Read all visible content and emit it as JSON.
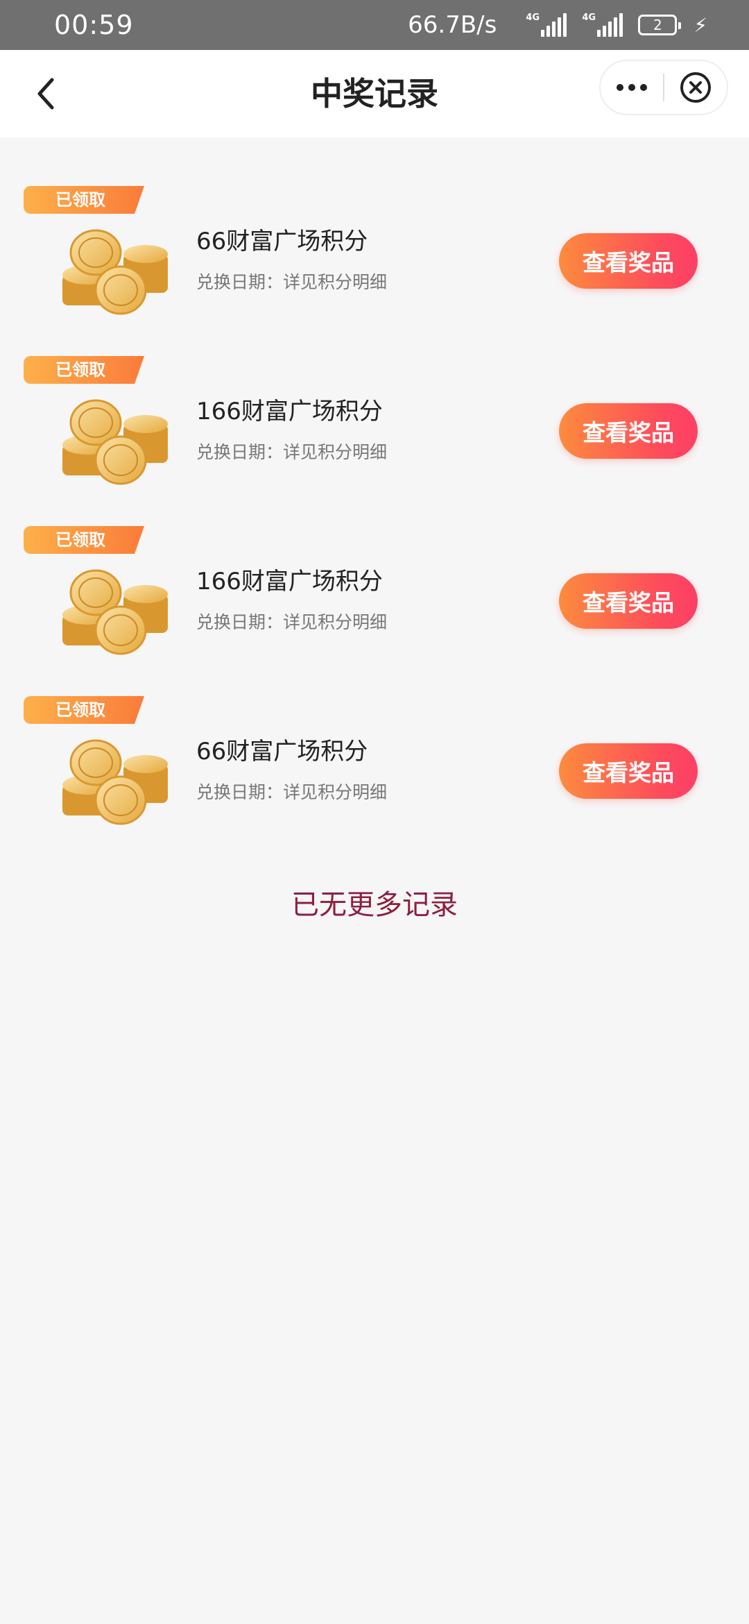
{
  "status_bar": {
    "time": "00:59",
    "net_speed": "66.7B/s",
    "signal1_label": "4G",
    "signal2_label": "4G",
    "battery_level": "2"
  },
  "nav": {
    "title": "中奖记录"
  },
  "records": [
    {
      "badge": "已领取",
      "title": "66财富广场积分",
      "date": "兑换日期：详见积分明细",
      "button": "查看奖品"
    },
    {
      "badge": "已领取",
      "title": "166财富广场积分",
      "date": "兑换日期：详见积分明细",
      "button": "查看奖品"
    },
    {
      "badge": "已领取",
      "title": "166财富广场积分",
      "date": "兑换日期：详见积分明细",
      "button": "查看奖品"
    },
    {
      "badge": "已领取",
      "title": "66财富广场积分",
      "date": "兑换日期：详见积分明细",
      "button": "查看奖品"
    }
  ],
  "footer": {
    "no_more": "已无更多记录"
  },
  "icons": {
    "back": "back-arrow-icon",
    "more": "more-dots-icon",
    "close": "close-circle-icon",
    "coins": "gold-coins-icon"
  },
  "colors": {
    "accent_button_start": "#fd8b3e",
    "accent_button_end": "#fd3f66",
    "badge_start": "#fcb04a",
    "badge_end": "#fb7b3a",
    "no_more_text": "#8c1f3f"
  }
}
